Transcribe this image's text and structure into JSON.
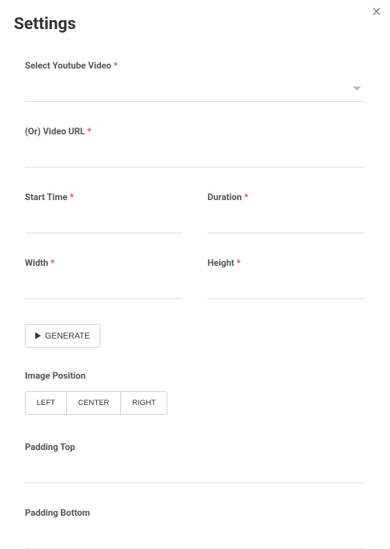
{
  "title": "Settings",
  "closeIcon": "✕",
  "fields": {
    "selectVideo": {
      "label": "Select Youtube Video",
      "required": "*"
    },
    "videoUrl": {
      "label": "(Or) Video URL",
      "required": "*",
      "value": ""
    },
    "startTime": {
      "label": "Start Time",
      "required": "*",
      "value": ""
    },
    "duration": {
      "label": "Duration",
      "required": "*",
      "value": ""
    },
    "width": {
      "label": "Width",
      "required": "*",
      "value": ""
    },
    "height": {
      "label": "Height",
      "required": "*",
      "value": ""
    },
    "paddingTop": {
      "label": "Padding Top",
      "value": ""
    },
    "paddingBottom": {
      "label": "Padding Bottom",
      "value": ""
    }
  },
  "buttons": {
    "generate": "GENERATE"
  },
  "imagePosition": {
    "label": "Image Position",
    "options": {
      "left": "LEFT",
      "center": "CENTER",
      "right": "RIGHT"
    }
  }
}
